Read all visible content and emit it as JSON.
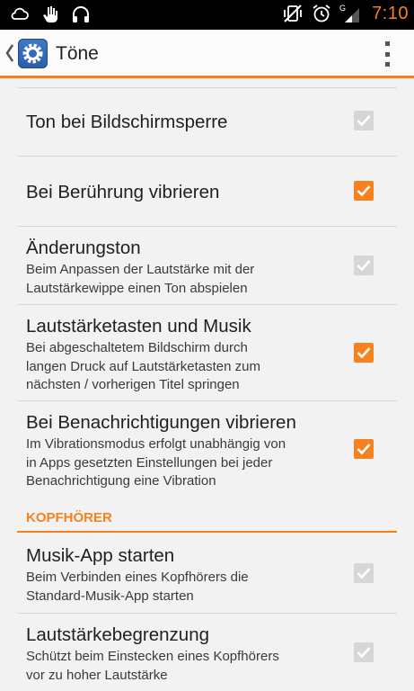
{
  "status_bar": {
    "time": "7:10"
  },
  "header": {
    "title": "Töne"
  },
  "colors": {
    "accent": "#f5821f",
    "disabled_checkbox": "#d6d6d6"
  },
  "items": [
    {
      "title": "Ton bei Bildschirmsperre",
      "checked": true,
      "enabled": false
    },
    {
      "title": "Bei Berührung vibrieren",
      "checked": true,
      "enabled": true
    },
    {
      "title": "Änderungston",
      "line1": "Beim Anpassen der Lautstärke mit der",
      "line2": "Lautstärkewippe einen Ton abspielen",
      "checked": true,
      "enabled": false
    },
    {
      "title": "Lautstärketasten und Musik",
      "line1": "Bei abgeschaltetem Bildschirm durch",
      "line2": "langen Druck auf Lautstärketasten zum",
      "line3": "nächsten / vorherigen Titel springen",
      "checked": true,
      "enabled": true
    },
    {
      "title": "Bei Benachrichtigungen vibrieren",
      "line1": "Im Vibrationsmodus erfolgt unabhängig von",
      "line2": "in Apps gesetzten Einstellungen bei jeder",
      "line3": "Benachrichtigung eine Vibration",
      "checked": true,
      "enabled": true
    }
  ],
  "section": {
    "label": "KOPFHÖRER"
  },
  "headphone_items": [
    {
      "title": "Musik-App starten",
      "line1": "Beim Verbinden eines Kopfhörers die",
      "line2": "Standard-Musik-App starten",
      "checked": true,
      "enabled": false
    },
    {
      "title": "Lautstärkebegrenzung",
      "line1": "Schützt beim Einstecken eines Kopfhörers",
      "line2": "vor zu hoher Lautstärke",
      "checked": true,
      "enabled": false
    }
  ],
  "icons": [
    "cloud-icon",
    "hand-icon",
    "headphones-icon",
    "vibrate-off-icon",
    "alarm-icon",
    "signal-icon",
    "back-chevron-icon",
    "settings-app-icon",
    "overflow-menu-icon",
    "check-icon"
  ]
}
